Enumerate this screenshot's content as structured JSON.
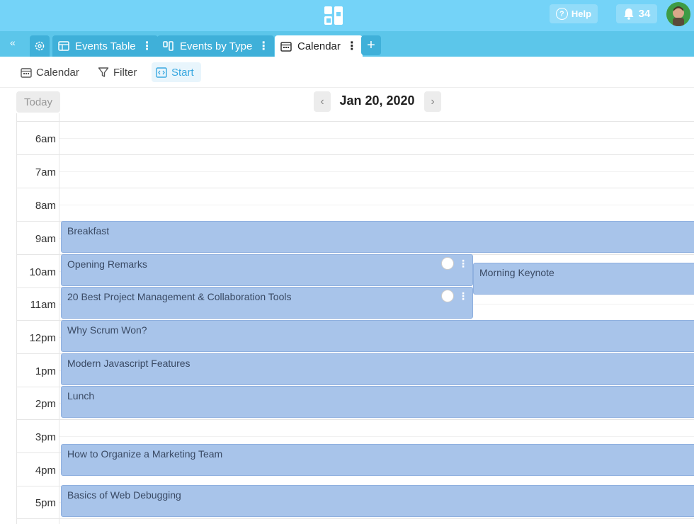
{
  "topbar": {
    "help_label": "Help",
    "notification_count": "34"
  },
  "tabs": [
    {
      "label": "Events Table",
      "icon": "table-icon"
    },
    {
      "label": "Events by Type",
      "icon": "kanban-icon"
    },
    {
      "label": "Calendar",
      "icon": "calendar-icon",
      "active": true
    }
  ],
  "toolbar": {
    "calendar_label": "Calendar",
    "filter_label": "Filter",
    "start_label": "Start"
  },
  "calendar": {
    "today_label": "Today",
    "date": "Jan 20, 2020",
    "hours": [
      "6am",
      "7am",
      "8am",
      "9am",
      "10am",
      "11am",
      "12pm",
      "1pm",
      "2pm",
      "3pm",
      "4pm",
      "5pm"
    ],
    "events": [
      {
        "title": "Breakfast"
      },
      {
        "title": "Opening Remarks"
      },
      {
        "title": "Morning Keynote"
      },
      {
        "title": "20 Best Project Management & Collaboration Tools"
      },
      {
        "title": "Why Scrum Won?"
      },
      {
        "title": "Modern Javascript Features"
      },
      {
        "title": "Lunch"
      },
      {
        "title": "How to Organize a Marketing Team"
      },
      {
        "title": "Basics of Web Debugging"
      }
    ]
  },
  "colors": {
    "topbar": "#74d3f8",
    "tabbar": "#5cc6ea",
    "event": "#a8c4ea",
    "accent": "#39a8e0"
  }
}
